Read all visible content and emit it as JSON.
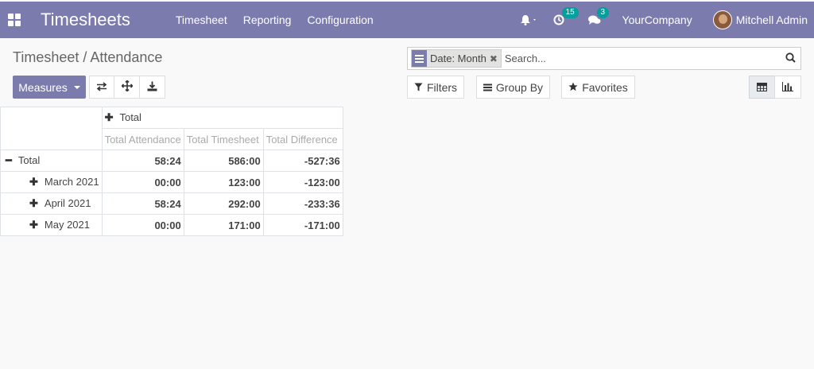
{
  "navbar": {
    "app_title": "Timesheets",
    "menu": [
      "Timesheet",
      "Reporting",
      "Configuration"
    ],
    "activity_badge": "15",
    "messages_badge": "3",
    "company": "YourCompany",
    "user": "Mitchell Admin"
  },
  "control_panel": {
    "breadcrumb": "Timesheet / Attendance",
    "facet_value": "Date: Month",
    "search_placeholder": "Search...",
    "measures_label": "Measures",
    "filters_label": "Filters",
    "group_by_label": "Group By",
    "favorites_label": "Favorites"
  },
  "pivot": {
    "column_total_label": "Total",
    "measures": [
      "Total Attendance",
      "Total Timesheet",
      "Total Difference"
    ],
    "rows": [
      {
        "label": "Total",
        "values": [
          "58:24",
          "586:00",
          "-527:36"
        ]
      },
      {
        "label": "March 2021",
        "values": [
          "00:00",
          "123:00",
          "-123:00"
        ]
      },
      {
        "label": "April 2021",
        "values": [
          "58:24",
          "292:00",
          "-233:36"
        ]
      },
      {
        "label": "May 2021",
        "values": [
          "00:00",
          "171:00",
          "-171:00"
        ]
      }
    ]
  },
  "colors": {
    "brand": "#7c7bad",
    "badge": "#00a09d"
  }
}
